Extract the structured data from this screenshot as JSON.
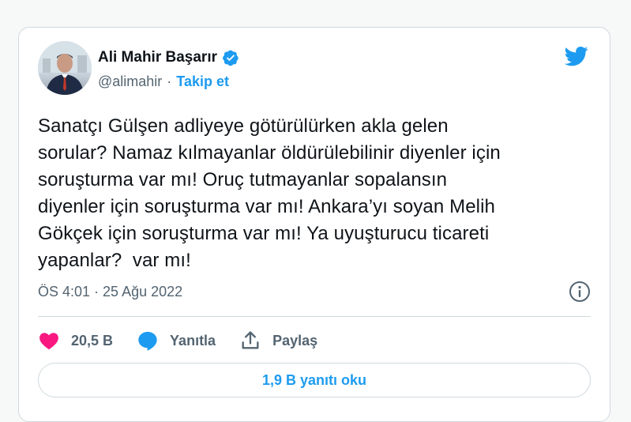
{
  "colors": {
    "accent": "#1d9bf0",
    "like": "#f91880",
    "muted": "#536471",
    "text": "#0f1419"
  },
  "author": {
    "name": "Ali Mahir Başarır",
    "handle": "@alimahir",
    "separator": "·",
    "follow_label": "Takip et",
    "verified_icon": "verified-badge-icon",
    "avatar": "avatar"
  },
  "logo_icon": "twitter-bird-icon",
  "tweet": {
    "text": "Sanatçı Gülşen adliyeye götürülürken akla gelen\nsorular? Namaz kılmayanlar öldürülebilinir diyenler için\nsoruşturma var mı! Oruç tutmayanlar sopalansın\ndiyenler için soruşturma var mı! Ankara’yı soyan Melih\nGökçek için soruşturma var mı! Ya uyuşturucu ticareti\nyapanlar?  var mı!",
    "timestamp": "ÖS 4:01 · 25 Ağu 2022",
    "info_icon": "info-icon"
  },
  "actions": {
    "like_count": "20,5 B",
    "reply_label": "Yanıtla",
    "share_label": "Paylaş"
  },
  "replies_button": "1,9 B yanıtı oku"
}
